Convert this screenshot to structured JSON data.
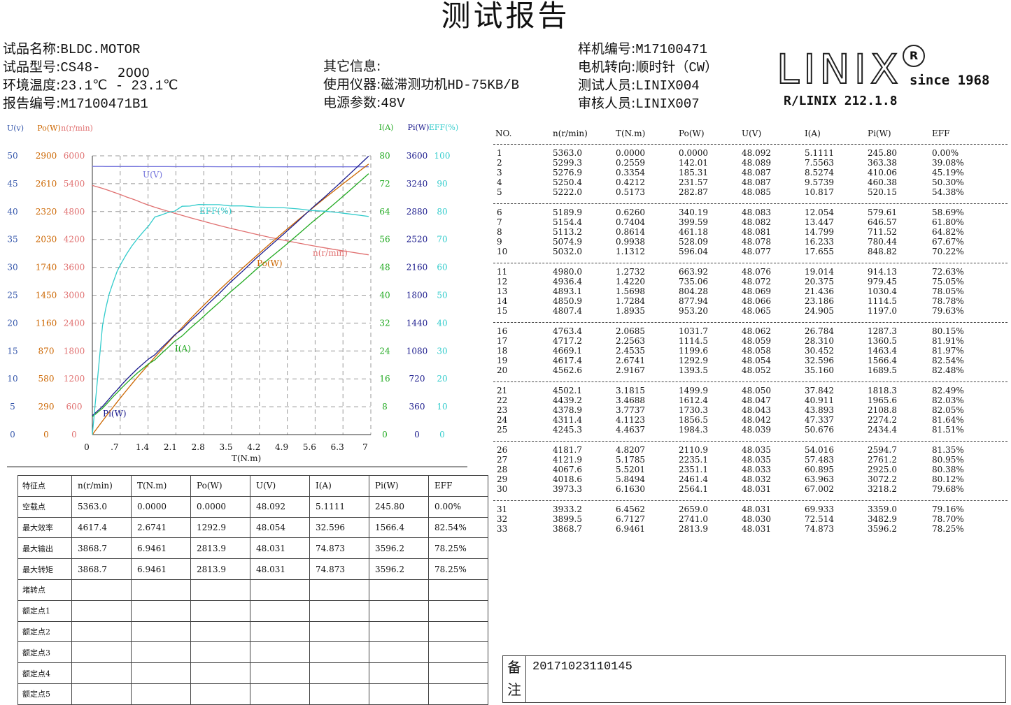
{
  "title": "测试报告",
  "info": {
    "left": [
      {
        "label": "试品名称:",
        "value": "BLDC.MOTOR"
      },
      {
        "label": "试品型号:",
        "value": "CS48-"
      },
      {
        "label": "环境温度:",
        "value": "23.1℃ - 23.1℃"
      },
      {
        "label": "报告编号:",
        "value": "M17100471B1"
      }
    ],
    "model_suffix": "2000",
    "middle": [
      {
        "label": "其它信息:",
        "value": ""
      },
      {
        "label": "使用仪器:",
        "value": "磁滞测功机HD-75KB/B"
      },
      {
        "label": "电源参数:",
        "value": "48V"
      }
    ],
    "right": [
      {
        "label": "样机编号:",
        "value": "M17100471"
      },
      {
        "label": "电机转向:",
        "value": "顺时针（CW）"
      },
      {
        "label": "测试人员:",
        "value": "LINIX004"
      },
      {
        "label": "审核人员:",
        "value": "LINIX007"
      }
    ]
  },
  "logo": {
    "brand": "LINIX",
    "reg": "R",
    "since": "since 1968",
    "sub": "R/LINIX 212.1.8"
  },
  "chart_data": {
    "type": "line",
    "xlabel": "T(N.m)",
    "x_ticks": [
      "0",
      ".7",
      "1.4",
      "2.1",
      "2.8",
      "3.5",
      "4.2",
      "4.9",
      "5.6",
      "6.3",
      "7"
    ],
    "xlim": [
      0,
      7
    ],
    "left_axes": [
      {
        "name": "U(v)",
        "color": "#3355aa",
        "ticks": [
          "0",
          "5",
          "10",
          "15",
          "20",
          "25",
          "30",
          "35",
          "40",
          "45",
          "50"
        ]
      },
      {
        "name": "Po(W)",
        "color": "#cc6600",
        "ticks": [
          "0",
          "290",
          "580",
          "870",
          "1160",
          "1450",
          "1740",
          "2030",
          "2320",
          "2610",
          "2900"
        ]
      },
      {
        "name": "n(r/min)",
        "color": "#e07070",
        "ticks": [
          "0",
          "600",
          "1200",
          "1800",
          "2400",
          "3000",
          "3600",
          "4200",
          "4800",
          "5400",
          "6000"
        ]
      }
    ],
    "right_axes": [
      {
        "name": "I(A)",
        "color": "#22aa22",
        "ticks": [
          "0",
          "8",
          "16",
          "24",
          "32",
          "40",
          "48",
          "56",
          "64",
          "72",
          "80"
        ]
      },
      {
        "name": "Pi(W)",
        "color": "#1a1a8c",
        "ticks": [
          "0",
          "360",
          "720",
          "1080",
          "1440",
          "1800",
          "2160",
          "2520",
          "2880",
          "3240",
          "3600"
        ]
      },
      {
        "name": "EFF(%)",
        "color": "#33cccc",
        "ticks": [
          "0",
          "10",
          "20",
          "30",
          "40",
          "50",
          "60",
          "70",
          "80",
          "90",
          "100"
        ]
      }
    ],
    "grid": true,
    "series_labels": [
      {
        "name": "U(V)",
        "color": "#7777dd"
      },
      {
        "name": "EFF(%)",
        "color": "#33cccc"
      },
      {
        "name": "n(r/min)",
        "color": "#e07070"
      },
      {
        "name": "Po(W)",
        "color": "#cc6600"
      },
      {
        "name": "I(A)",
        "color": "#22aa22"
      },
      {
        "name": "Pi(W)",
        "color": "#1a1a8c"
      }
    ],
    "series": [
      {
        "name": "U(V)",
        "axis": "U(v)",
        "color": "#7777dd",
        "x": [
          0.0,
          0.2559,
          0.3354,
          0.4212,
          0.5173,
          0.626,
          0.7404,
          0.8614,
          0.9938,
          1.1312,
          1.2732,
          1.422,
          1.5698,
          1.7284,
          1.8935,
          2.0685,
          2.2563,
          2.4535,
          2.6741,
          2.9167,
          3.1815,
          3.4688,
          3.7737,
          4.1123,
          4.4637,
          4.8207,
          5.1785,
          5.5201,
          5.8494,
          6.163,
          6.4562,
          6.7127,
          6.9461
        ],
        "y": [
          48.092,
          48.089,
          48.087,
          48.087,
          48.085,
          48.083,
          48.082,
          48.081,
          48.078,
          48.077,
          48.076,
          48.072,
          48.069,
          48.066,
          48.065,
          48.062,
          48.059,
          48.058,
          48.054,
          48.052,
          48.05,
          48.047,
          48.043,
          48.042,
          48.039,
          48.035,
          48.035,
          48.033,
          48.032,
          48.031,
          48.031,
          48.03,
          48.031
        ]
      },
      {
        "name": "n(r/min)",
        "axis": "n(r/min)",
        "color": "#e07070",
        "x": [
          0.0,
          0.2559,
          0.3354,
          0.4212,
          0.5173,
          0.626,
          0.7404,
          0.8614,
          0.9938,
          1.1312,
          1.2732,
          1.422,
          1.5698,
          1.7284,
          1.8935,
          2.0685,
          2.2563,
          2.4535,
          2.6741,
          2.9167,
          3.1815,
          3.4688,
          3.7737,
          4.1123,
          4.4637,
          4.8207,
          5.1785,
          5.5201,
          5.8494,
          6.163,
          6.4562,
          6.7127,
          6.9461
        ],
        "y": [
          5363.0,
          5299.3,
          5276.9,
          5250.4,
          5222.0,
          5189.9,
          5154.4,
          5113.2,
          5074.9,
          5032.0,
          4980.0,
          4936.4,
          4893.1,
          4850.9,
          4807.4,
          4763.4,
          4717.2,
          4669.1,
          4617.4,
          4562.6,
          4502.1,
          4439.2,
          4378.9,
          4311.4,
          4245.3,
          4181.7,
          4121.9,
          4067.6,
          4018.6,
          3973.3,
          3933.2,
          3899.5,
          3868.7
        ]
      },
      {
        "name": "Po(W)",
        "axis": "Po(W)",
        "color": "#cc6600",
        "x": [
          0.0,
          0.2559,
          0.3354,
          0.4212,
          0.5173,
          0.626,
          0.7404,
          0.8614,
          0.9938,
          1.1312,
          1.2732,
          1.422,
          1.5698,
          1.7284,
          1.8935,
          2.0685,
          2.2563,
          2.4535,
          2.6741,
          2.9167,
          3.1815,
          3.4688,
          3.7737,
          4.1123,
          4.4637,
          4.8207,
          5.1785,
          5.5201,
          5.8494,
          6.163,
          6.4562,
          6.7127,
          6.9461
        ],
        "y": [
          0.0,
          142.01,
          185.31,
          231.57,
          282.87,
          340.19,
          399.59,
          461.18,
          528.09,
          596.04,
          663.92,
          735.06,
          804.28,
          877.94,
          953.2,
          1031.7,
          1114.5,
          1199.6,
          1292.9,
          1393.5,
          1499.9,
          1612.4,
          1730.3,
          1856.5,
          1984.3,
          2110.9,
          2235.1,
          2351.1,
          2461.4,
          2564.1,
          2659.0,
          2741.0,
          2813.9
        ]
      },
      {
        "name": "I(A)",
        "axis": "I(A)",
        "color": "#22aa22",
        "x": [
          0.0,
          0.2559,
          0.3354,
          0.4212,
          0.5173,
          0.626,
          0.7404,
          0.8614,
          0.9938,
          1.1312,
          1.2732,
          1.422,
          1.5698,
          1.7284,
          1.8935,
          2.0685,
          2.2563,
          2.4535,
          2.6741,
          2.9167,
          3.1815,
          3.4688,
          3.7737,
          4.1123,
          4.4637,
          4.8207,
          5.1785,
          5.5201,
          5.8494,
          6.163,
          6.4562,
          6.7127,
          6.9461
        ],
        "y": [
          5.1111,
          7.5563,
          8.5274,
          9.5739,
          10.817,
          12.054,
          13.447,
          14.799,
          16.233,
          17.655,
          19.014,
          20.375,
          21.436,
          23.186,
          24.905,
          26.784,
          28.31,
          30.452,
          32.596,
          35.16,
          37.842,
          40.911,
          43.893,
          47.337,
          50.676,
          54.016,
          57.483,
          60.895,
          63.963,
          67.002,
          69.933,
          72.514,
          74.873
        ]
      },
      {
        "name": "Pi(W)",
        "axis": "Pi(W)",
        "color": "#1a1a8c",
        "x": [
          0.0,
          0.2559,
          0.3354,
          0.4212,
          0.5173,
          0.626,
          0.7404,
          0.8614,
          0.9938,
          1.1312,
          1.2732,
          1.422,
          1.5698,
          1.7284,
          1.8935,
          2.0685,
          2.2563,
          2.4535,
          2.6741,
          2.9167,
          3.1815,
          3.4688,
          3.7737,
          4.1123,
          4.4637,
          4.8207,
          5.1785,
          5.5201,
          5.8494,
          6.163,
          6.4562,
          6.7127,
          6.9461
        ],
        "y": [
          245.8,
          363.38,
          410.06,
          460.38,
          520.15,
          579.61,
          646.57,
          711.52,
          780.44,
          848.82,
          914.13,
          979.45,
          1030.4,
          1114.5,
          1197.0,
          1287.3,
          1360.5,
          1463.4,
          1566.4,
          1689.5,
          1818.3,
          1965.6,
          2108.8,
          2274.2,
          2434.4,
          2594.7,
          2761.2,
          2925.0,
          3072.2,
          3218.2,
          3359.0,
          3482.9,
          3596.2
        ]
      },
      {
        "name": "EFF(%)",
        "axis": "EFF(%)",
        "color": "#33cccc",
        "x": [
          0.0,
          0.2559,
          0.3354,
          0.4212,
          0.5173,
          0.626,
          0.7404,
          0.8614,
          0.9938,
          1.1312,
          1.2732,
          1.422,
          1.5698,
          1.7284,
          1.8935,
          2.0685,
          2.2563,
          2.4535,
          2.6741,
          2.9167,
          3.1815,
          3.4688,
          3.7737,
          4.1123,
          4.4637,
          4.8207,
          5.1785,
          5.5201,
          5.8494,
          6.163,
          6.4562,
          6.7127,
          6.9461
        ],
        "y": [
          0.0,
          39.08,
          45.19,
          50.3,
          54.38,
          58.69,
          61.8,
          64.82,
          67.67,
          70.22,
          72.63,
          75.05,
          78.05,
          78.78,
          79.63,
          80.15,
          81.91,
          81.97,
          82.54,
          82.48,
          82.49,
          82.03,
          82.05,
          81.64,
          81.51,
          81.35,
          80.95,
          80.38,
          80.12,
          79.68,
          79.16,
          78.7,
          78.25
        ]
      }
    ]
  },
  "feature_table": {
    "headers": [
      "特征点",
      "n(r/min)",
      "T(N.m)",
      "Po(W)",
      "U(V)",
      "I(A)",
      "Pi(W)",
      "EFF"
    ],
    "rows": [
      [
        "空载点",
        "5363.0",
        "0.0000",
        "0.0000",
        "48.092",
        "5.1111",
        "245.80",
        "0.00%"
      ],
      [
        "最大效率",
        "4617.4",
        "2.6741",
        "1292.9",
        "48.054",
        "32.596",
        "1566.4",
        "82.54%"
      ],
      [
        "最大输出",
        "3868.7",
        "6.9461",
        "2813.9",
        "48.031",
        "74.873",
        "3596.2",
        "78.25%"
      ],
      [
        "最大转矩",
        "3868.7",
        "6.9461",
        "2813.9",
        "48.031",
        "74.873",
        "3596.2",
        "78.25%"
      ],
      [
        "堵转点",
        "",
        "",
        "",
        "",
        "",
        "",
        ""
      ],
      [
        "额定点1",
        "",
        "",
        "",
        "",
        "",
        "",
        ""
      ],
      [
        "额定点2",
        "",
        "",
        "",
        "",
        "",
        "",
        ""
      ],
      [
        "额定点3",
        "",
        "",
        "",
        "",
        "",
        "",
        ""
      ],
      [
        "额定点4",
        "",
        "",
        "",
        "",
        "",
        "",
        ""
      ],
      [
        "额定点5",
        "",
        "",
        "",
        "",
        "",
        "",
        ""
      ]
    ]
  },
  "data_table": {
    "headers": [
      "NO.",
      "n(r/min)",
      "T(N.m)",
      "Po(W)",
      "U(V)",
      "I(A)",
      "Pi(W)",
      "EFF"
    ],
    "rows": [
      [
        "1",
        "5363.0",
        "0.0000",
        "0.0000",
        "48.092",
        "5.1111",
        "245.80",
        "0.00%"
      ],
      [
        "2",
        "5299.3",
        "0.2559",
        "142.01",
        "48.089",
        "7.5563",
        "363.38",
        "39.08%"
      ],
      [
        "3",
        "5276.9",
        "0.3354",
        "185.31",
        "48.087",
        "8.5274",
        "410.06",
        "45.19%"
      ],
      [
        "4",
        "5250.4",
        "0.4212",
        "231.57",
        "48.087",
        "9.5739",
        "460.38",
        "50.30%"
      ],
      [
        "5",
        "5222.0",
        "0.5173",
        "282.87",
        "48.085",
        "10.817",
        "520.15",
        "54.38%"
      ],
      [
        "6",
        "5189.9",
        "0.6260",
        "340.19",
        "48.083",
        "12.054",
        "579.61",
        "58.69%"
      ],
      [
        "7",
        "5154.4",
        "0.7404",
        "399.59",
        "48.082",
        "13.447",
        "646.57",
        "61.80%"
      ],
      [
        "8",
        "5113.2",
        "0.8614",
        "461.18",
        "48.081",
        "14.799",
        "711.52",
        "64.82%"
      ],
      [
        "9",
        "5074.9",
        "0.9938",
        "528.09",
        "48.078",
        "16.233",
        "780.44",
        "67.67%"
      ],
      [
        "10",
        "5032.0",
        "1.1312",
        "596.04",
        "48.077",
        "17.655",
        "848.82",
        "70.22%"
      ],
      [
        "11",
        "4980.0",
        "1.2732",
        "663.92",
        "48.076",
        "19.014",
        "914.13",
        "72.63%"
      ],
      [
        "12",
        "4936.4",
        "1.4220",
        "735.06",
        "48.072",
        "20.375",
        "979.45",
        "75.05%"
      ],
      [
        "13",
        "4893.1",
        "1.5698",
        "804.28",
        "48.069",
        "21.436",
        "1030.4",
        "78.05%"
      ],
      [
        "14",
        "4850.9",
        "1.7284",
        "877.94",
        "48.066",
        "23.186",
        "1114.5",
        "78.78%"
      ],
      [
        "15",
        "4807.4",
        "1.8935",
        "953.20",
        "48.065",
        "24.905",
        "1197.0",
        "79.63%"
      ],
      [
        "16",
        "4763.4",
        "2.0685",
        "1031.7",
        "48.062",
        "26.784",
        "1287.3",
        "80.15%"
      ],
      [
        "17",
        "4717.2",
        "2.2563",
        "1114.5",
        "48.059",
        "28.310",
        "1360.5",
        "81.91%"
      ],
      [
        "18",
        "4669.1",
        "2.4535",
        "1199.6",
        "48.058",
        "30.452",
        "1463.4",
        "81.97%"
      ],
      [
        "19",
        "4617.4",
        "2.6741",
        "1292.9",
        "48.054",
        "32.596",
        "1566.4",
        "82.54%"
      ],
      [
        "20",
        "4562.6",
        "2.9167",
        "1393.5",
        "48.052",
        "35.160",
        "1689.5",
        "82.48%"
      ],
      [
        "21",
        "4502.1",
        "3.1815",
        "1499.9",
        "48.050",
        "37.842",
        "1818.3",
        "82.49%"
      ],
      [
        "22",
        "4439.2",
        "3.4688",
        "1612.4",
        "48.047",
        "40.911",
        "1965.6",
        "82.03%"
      ],
      [
        "23",
        "4378.9",
        "3.7737",
        "1730.3",
        "48.043",
        "43.893",
        "2108.8",
        "82.05%"
      ],
      [
        "24",
        "4311.4",
        "4.1123",
        "1856.5",
        "48.042",
        "47.337",
        "2274.2",
        "81.64%"
      ],
      [
        "25",
        "4245.3",
        "4.4637",
        "1984.3",
        "48.039",
        "50.676",
        "2434.4",
        "81.51%"
      ],
      [
        "26",
        "4181.7",
        "4.8207",
        "2110.9",
        "48.035",
        "54.016",
        "2594.7",
        "81.35%"
      ],
      [
        "27",
        "4121.9",
        "5.1785",
        "2235.1",
        "48.035",
        "57.483",
        "2761.2",
        "80.95%"
      ],
      [
        "28",
        "4067.6",
        "5.5201",
        "2351.1",
        "48.033",
        "60.895",
        "2925.0",
        "80.38%"
      ],
      [
        "29",
        "4018.6",
        "5.8494",
        "2461.4",
        "48.032",
        "63.963",
        "3072.2",
        "80.12%"
      ],
      [
        "30",
        "3973.3",
        "6.1630",
        "2564.1",
        "48.031",
        "67.002",
        "3218.2",
        "79.68%"
      ],
      [
        "31",
        "3933.2",
        "6.4562",
        "2659.0",
        "48.031",
        "69.933",
        "3359.0",
        "79.16%"
      ],
      [
        "32",
        "3899.5",
        "6.7127",
        "2741.0",
        "48.030",
        "72.514",
        "3482.9",
        "78.70%"
      ],
      [
        "33",
        "3868.7",
        "6.9461",
        "2813.9",
        "48.031",
        "74.873",
        "3596.2",
        "78.25%"
      ]
    ]
  },
  "note": {
    "label": "备\n注",
    "value": "20171023110145"
  }
}
